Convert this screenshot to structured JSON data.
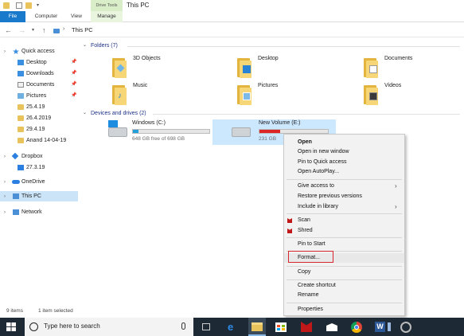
{
  "ribbon": {
    "context_group": "Drive Tools",
    "window_title": "This PC",
    "tabs": [
      "File",
      "Computer",
      "View",
      "Manage"
    ]
  },
  "address": {
    "path": "This PC"
  },
  "sidebar": {
    "items": [
      {
        "label": "Quick access",
        "icon": "star-icon"
      },
      {
        "label": "Desktop",
        "icon": "desktop-icon",
        "pinned": true
      },
      {
        "label": "Downloads",
        "icon": "download-icon",
        "pinned": true
      },
      {
        "label": "Documents",
        "icon": "documents-icon",
        "pinned": true
      },
      {
        "label": "Pictures",
        "icon": "pictures-icon",
        "pinned": true
      },
      {
        "label": "25.4.19",
        "icon": "folder-icon"
      },
      {
        "label": "26.4.2019",
        "icon": "folder-icon"
      },
      {
        "label": "29.4.19",
        "icon": "folder-icon"
      },
      {
        "label": "Anand 14-04-19",
        "icon": "folder-icon"
      },
      {
        "label": "Dropbox",
        "icon": "dropbox-icon"
      },
      {
        "label": "27.3.19",
        "icon": "folder-icon"
      },
      {
        "label": "OneDrive",
        "icon": "cloud-icon"
      },
      {
        "label": "This PC",
        "icon": "computer-icon",
        "selected": true
      },
      {
        "label": "Network",
        "icon": "network-icon"
      }
    ]
  },
  "folders": {
    "header": "Folders (7)",
    "items": [
      {
        "label": "3D Objects",
        "icon": "3d-objects-icon"
      },
      {
        "label": "Desktop",
        "icon": "desktop-folder-icon"
      },
      {
        "label": "Documents",
        "icon": "documents-folder-icon"
      },
      {
        "label": "Music",
        "icon": "music-folder-icon"
      },
      {
        "label": "Pictures",
        "icon": "pictures-folder-icon"
      },
      {
        "label": "Videos",
        "icon": "videos-folder-icon"
      }
    ]
  },
  "drives": {
    "header": "Devices and drives (2)",
    "items": [
      {
        "label": "Windows (C:)",
        "size": "648 GB free of 698 GB",
        "used_fraction": 0.07,
        "bar_color": "#26a0da"
      },
      {
        "label": "New Volume (E:)",
        "size": "231 GB",
        "used_fraction": 0.3,
        "bar_color": "#da2626",
        "selected": true
      }
    ]
  },
  "context_menu": {
    "items": [
      {
        "label": "Open",
        "bold": true
      },
      {
        "label": "Open in new window"
      },
      {
        "label": "Pin to Quick access"
      },
      {
        "label": "Open AutoPlay..."
      },
      {
        "label": "Give access to",
        "submenu": true
      },
      {
        "label": "Restore previous versions"
      },
      {
        "label": "Include in library",
        "submenu": true
      },
      {
        "label": "Scan",
        "icon": "mcafee-icon"
      },
      {
        "label": "Shred",
        "icon": "mcafee-icon"
      },
      {
        "label": "Pin to Start"
      },
      {
        "label": "Format...",
        "highlighted": true
      },
      {
        "label": "Copy"
      },
      {
        "label": "Create shortcut"
      },
      {
        "label": "Rename"
      },
      {
        "label": "Properties"
      }
    ],
    "highlight_color": "#d4262c"
  },
  "status": {
    "items_count": "9 items",
    "selected": "1 item selected"
  },
  "taskbar": {
    "search_placeholder": "Type here to search",
    "apps": [
      "task-view-icon",
      "edge-icon",
      "file-explorer-icon",
      "store-icon",
      "mcafee-icon",
      "mail-icon",
      "chrome-icon",
      "word-icon",
      "snipping-icon"
    ],
    "accent": "#1d2a36"
  }
}
